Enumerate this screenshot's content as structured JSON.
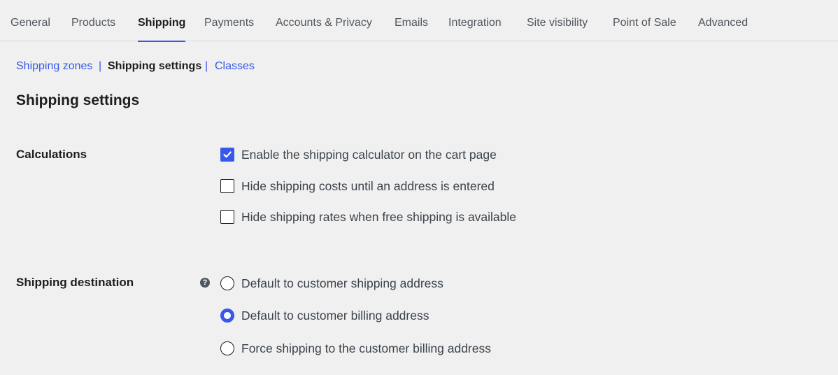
{
  "tabs": [
    {
      "label": "General"
    },
    {
      "label": "Products"
    },
    {
      "label": "Shipping"
    },
    {
      "label": "Payments"
    },
    {
      "label": "Accounts & Privacy"
    },
    {
      "label": "Emails"
    },
    {
      "label": "Integration"
    },
    {
      "label": "Site visibility"
    },
    {
      "label": "Point of Sale"
    },
    {
      "label": "Advanced"
    }
  ],
  "active_tab": "Shipping",
  "subnav": {
    "zones": "Shipping zones",
    "settings": "Shipping settings",
    "classes": "Classes",
    "separator": "|"
  },
  "page_title": "Shipping settings",
  "calculations": {
    "label": "Calculations",
    "options": [
      {
        "label": "Enable the shipping calculator on the cart page",
        "checked": true
      },
      {
        "label": "Hide shipping costs until an address is entered",
        "checked": false
      },
      {
        "label": "Hide shipping rates when free shipping is available",
        "checked": false
      }
    ]
  },
  "destination": {
    "label": "Shipping destination",
    "help_glyph": "?",
    "options": [
      {
        "label": "Default to customer shipping address",
        "selected": false
      },
      {
        "label": "Default to customer billing address",
        "selected": true
      },
      {
        "label": "Force shipping to the customer billing address",
        "selected": false
      }
    ]
  },
  "colors": {
    "accent": "#3858e9",
    "background": "#f0f0f0"
  }
}
